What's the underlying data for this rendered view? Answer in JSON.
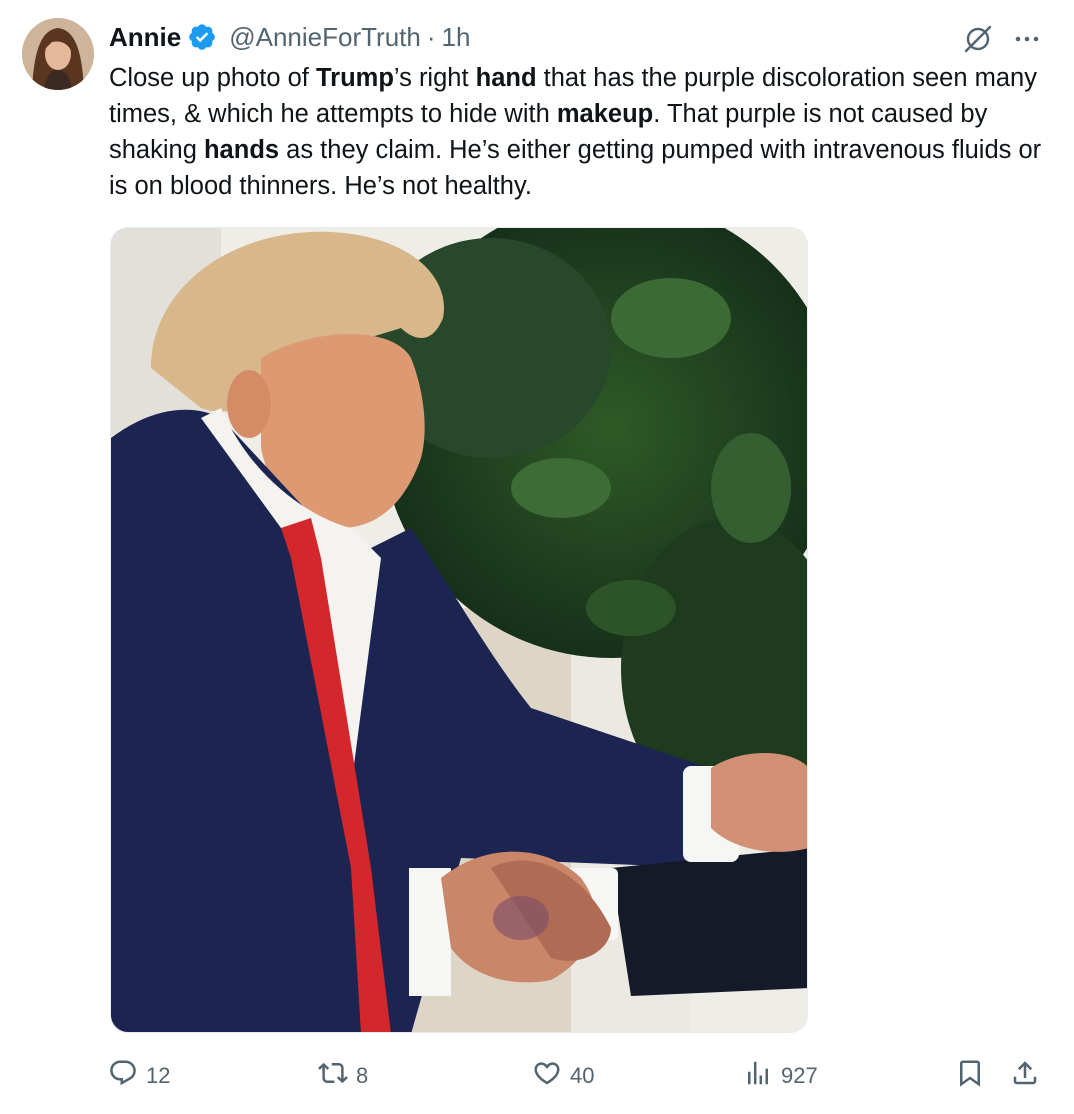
{
  "author": {
    "name": "Annie",
    "handle": "@AnnieForTruth",
    "separator": "·",
    "time": "1h"
  },
  "tweet": {
    "segments": [
      {
        "t": "Close up photo of ",
        "b": false
      },
      {
        "t": "Trump",
        "b": true
      },
      {
        "t": "’s right ",
        "b": false
      },
      {
        "t": "hand",
        "b": true
      },
      {
        "t": " that has the purple discoloration seen many times, & which he attempts to hide with ",
        "b": false
      },
      {
        "t": "makeup",
        "b": true
      },
      {
        "t": ". That purple is not caused by shaking ",
        "b": false
      },
      {
        "t": "hands",
        "b": true
      },
      {
        "t": " as they claim. He’s either getting pumped with intravenous fluids or is on blood thinners. He’s not healthy.",
        "b": false
      }
    ]
  },
  "stats": {
    "replies": "12",
    "reposts": "8",
    "likes": "40",
    "views": "927"
  },
  "icons": {
    "verified": "verified-badge-icon",
    "grok": "grok-icon",
    "more": "more-icon",
    "reply": "reply-icon",
    "repost": "repost-icon",
    "like": "like-icon",
    "views": "views-icon",
    "bookmark": "bookmark-icon",
    "share": "share-icon"
  },
  "colors": {
    "text": "#0f1419",
    "secondary": "#536471",
    "verified": "#1d9bf0",
    "suit": "#1c2552",
    "tie": "#d3272b"
  }
}
